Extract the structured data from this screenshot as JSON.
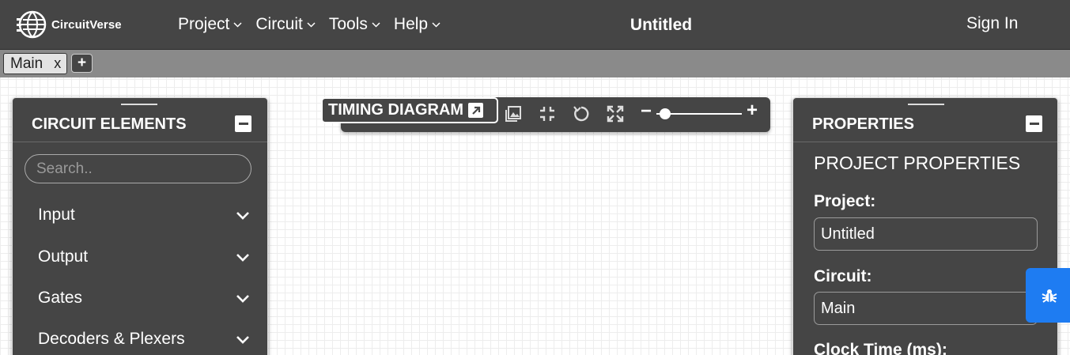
{
  "app": {
    "logo_text": "CircuitVerse",
    "title": "Untitled",
    "sign_in": "Sign In"
  },
  "menu": [
    {
      "label": "Project"
    },
    {
      "label": "Circuit"
    },
    {
      "label": "Tools"
    },
    {
      "label": "Help"
    }
  ],
  "tabs": {
    "items": [
      {
        "label": "Main",
        "close": "x"
      }
    ],
    "add_label": "+"
  },
  "elements_panel": {
    "title": "CIRCUIT ELEMENTS",
    "search_placeholder": "Search..",
    "categories": [
      {
        "label": "Input"
      },
      {
        "label": "Output"
      },
      {
        "label": "Gates"
      },
      {
        "label": "Decoders & Plexers"
      }
    ]
  },
  "timing": {
    "label": "TIMING DIAGRAM",
    "zoom_minus": "−",
    "zoom_plus": "+",
    "zoom_level": 0.1,
    "icons": [
      "image-icon",
      "collapse-icon",
      "reset-icon",
      "expand-icon"
    ]
  },
  "properties_panel": {
    "title": "PROPERTIES",
    "subtitle": "PROJECT PROPERTIES",
    "fields": [
      {
        "label": "Project:",
        "value": "Untitled"
      },
      {
        "label": "Circuit:",
        "value": "Main"
      },
      {
        "label": "Clock Time (ms):"
      }
    ]
  },
  "colors": {
    "navbar": "#454545",
    "tabbar": "#8a8a8a",
    "panel": "#454545",
    "bug_button": "#1e7cf2"
  }
}
